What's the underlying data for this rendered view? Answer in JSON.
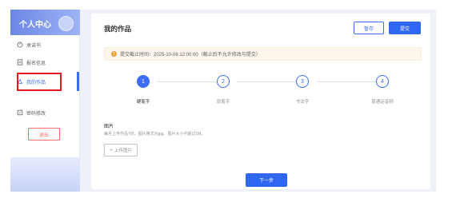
{
  "sidebar": {
    "title": "个人中心",
    "items": [
      {
        "label": "承诺书",
        "icon": "shield-icon"
      },
      {
        "label": "报名信息",
        "icon": "form-icon"
      },
      {
        "label": "我的作品",
        "icon": "works-icon"
      },
      {
        "label": "密码修改",
        "icon": "edit-icon"
      }
    ],
    "active_index": 2,
    "logout_label": "退出"
  },
  "main": {
    "title": "我的作品",
    "save_label": "暂存",
    "submit_label": "提交",
    "notice": "提交截止时间：2025-10-08 12:00:00（截止后不允许修改与提交）",
    "steps": [
      {
        "num": "1",
        "label": "硬笔字"
      },
      {
        "num": "2",
        "label": "软笔字"
      },
      {
        "num": "3",
        "label": "书法字"
      },
      {
        "num": "4",
        "label": "普通话音频"
      }
    ],
    "active_step": 0,
    "upload": {
      "label": "图片",
      "hint": "每月上传作品7份，图片格式为jpg、图片大小不超过1M。",
      "button_label": "上传图片"
    },
    "next_label": "下一步"
  },
  "colors": {
    "primary": "#3d6df2",
    "danger": "#f56c6c",
    "warning": "#e6a23c",
    "highlight_box": "#e3181e"
  }
}
